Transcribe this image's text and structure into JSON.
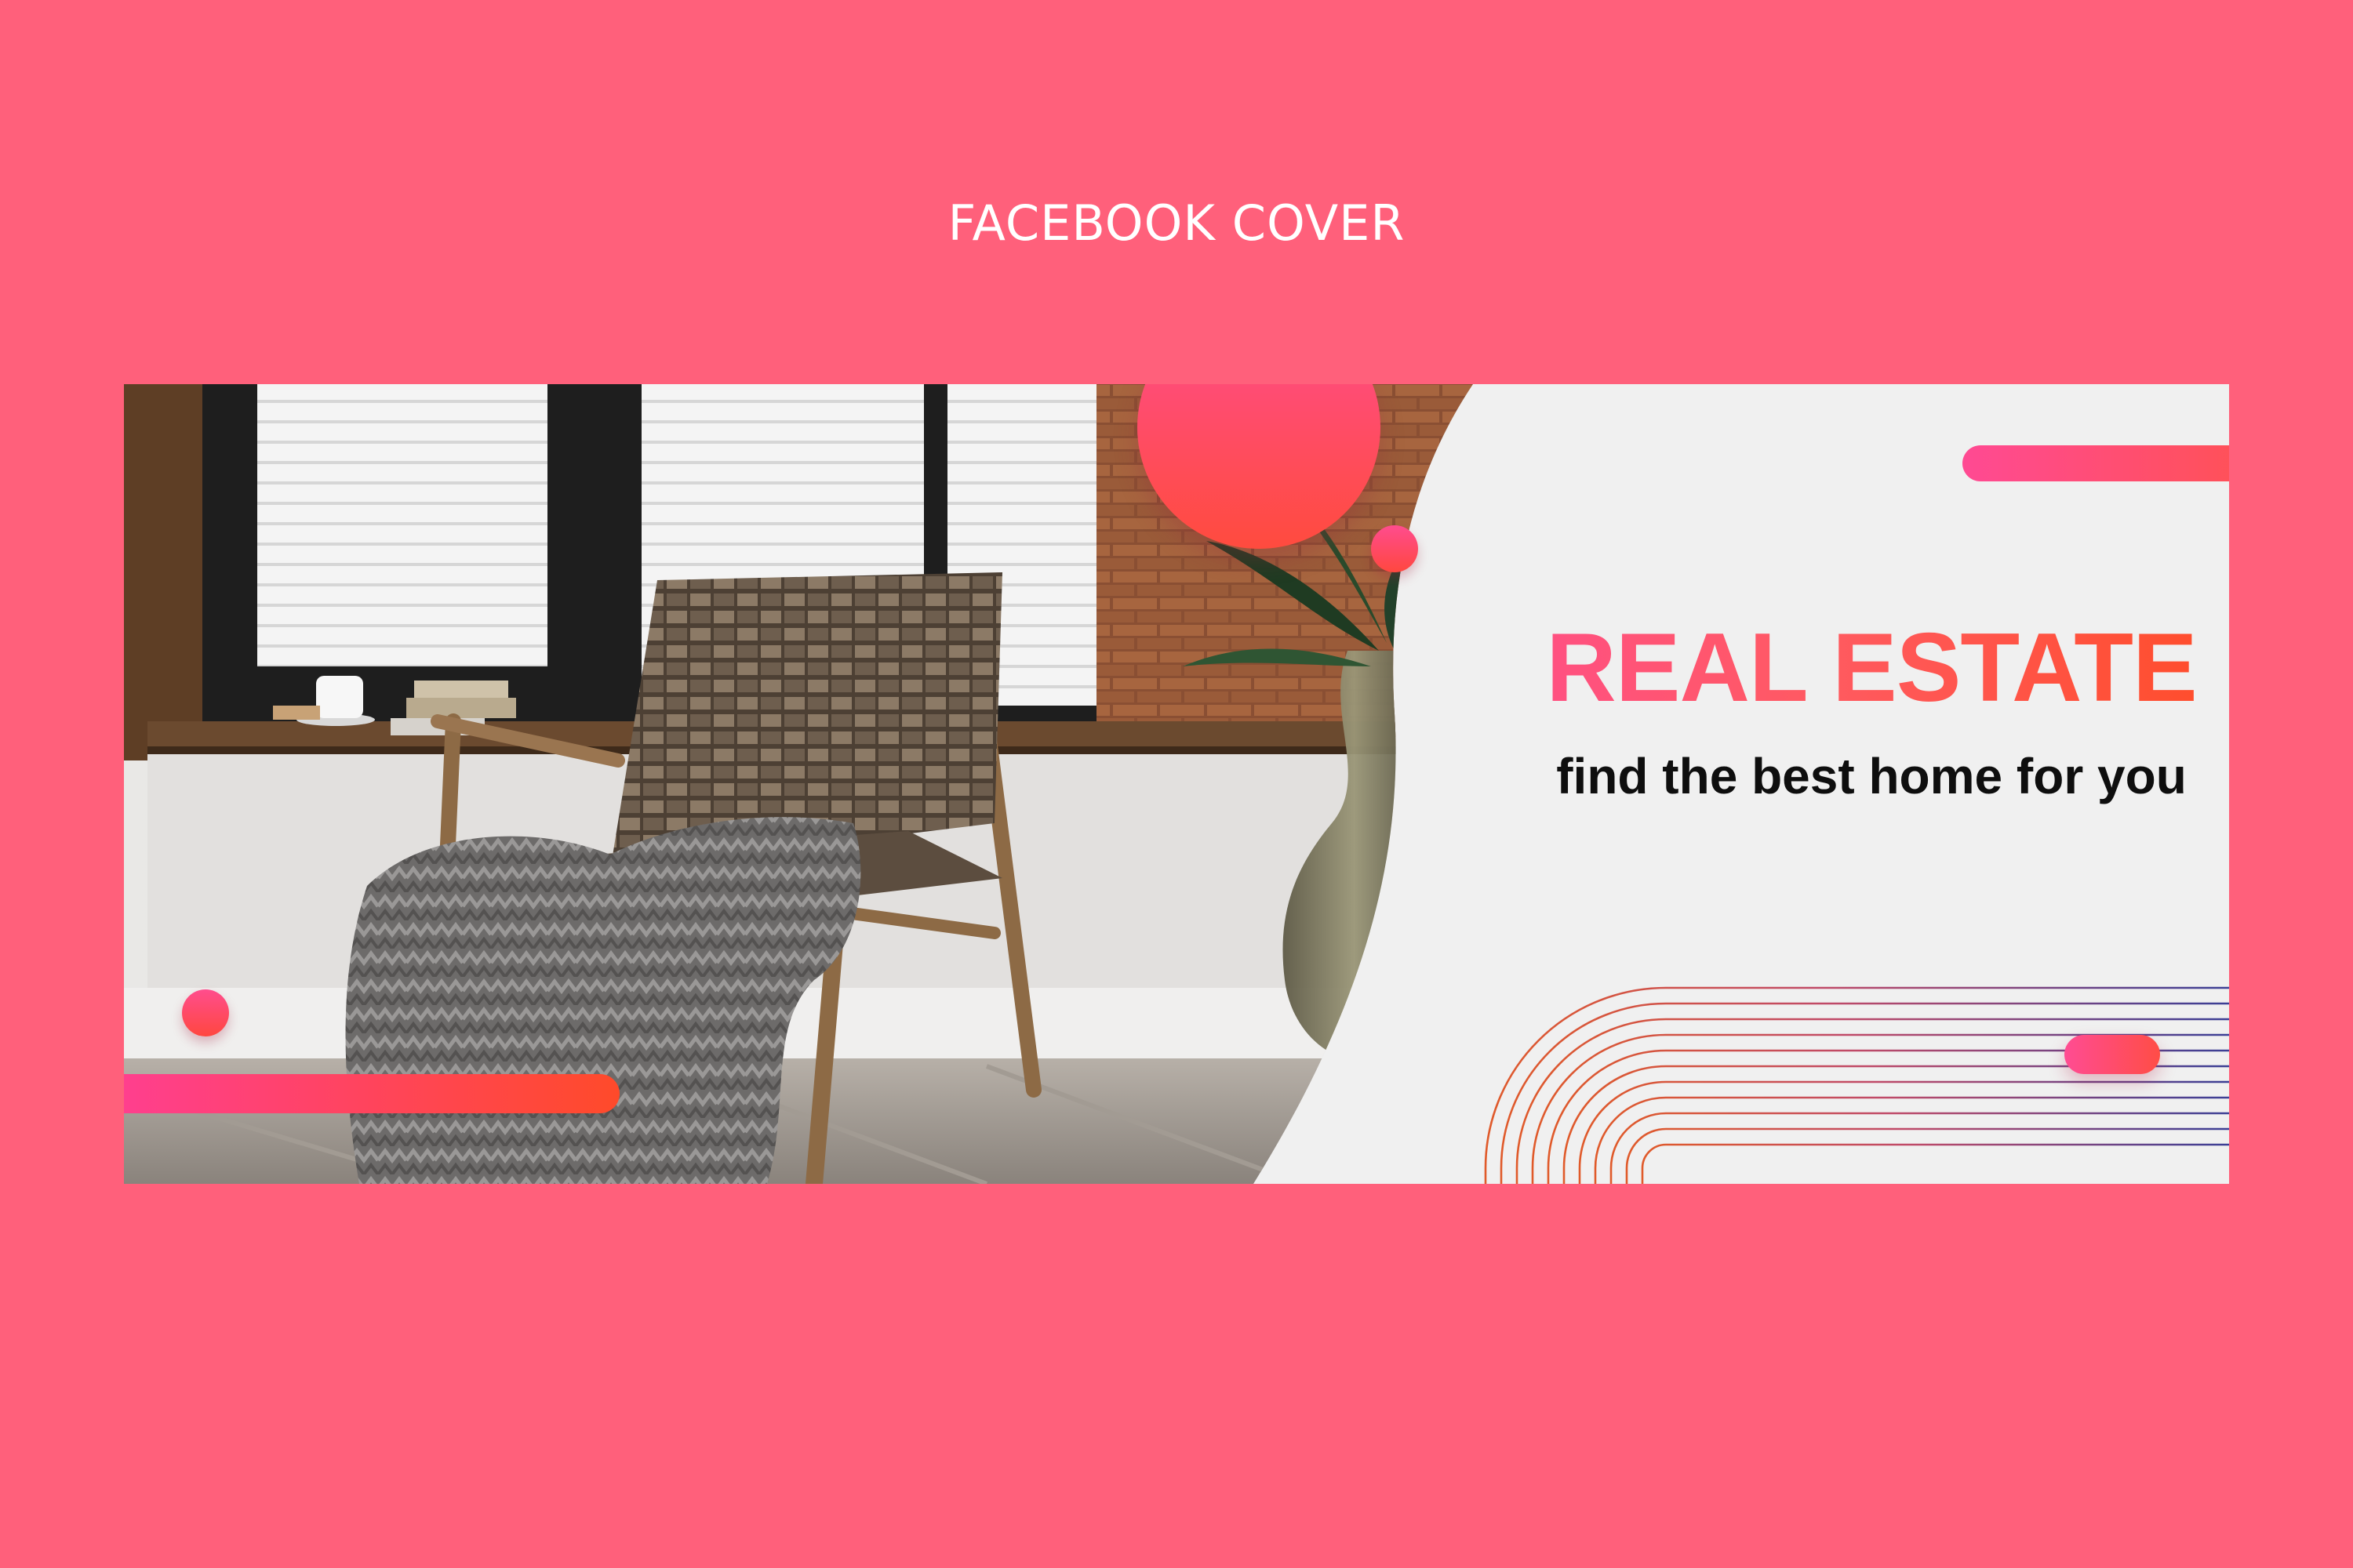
{
  "page": {
    "heading": "FACEBOOK COVER",
    "background_color": "#FF607B"
  },
  "cover": {
    "headline": "REAL ESTATE",
    "tagline": "find the best home for you",
    "panel_color": "#F0F0F0",
    "photo_description_icon": "armchair-photo"
  },
  "colors": {
    "accent_pink": "#FF4D8F",
    "accent_orange": "#FF4A1E",
    "text_dark": "#0E0E0E"
  }
}
